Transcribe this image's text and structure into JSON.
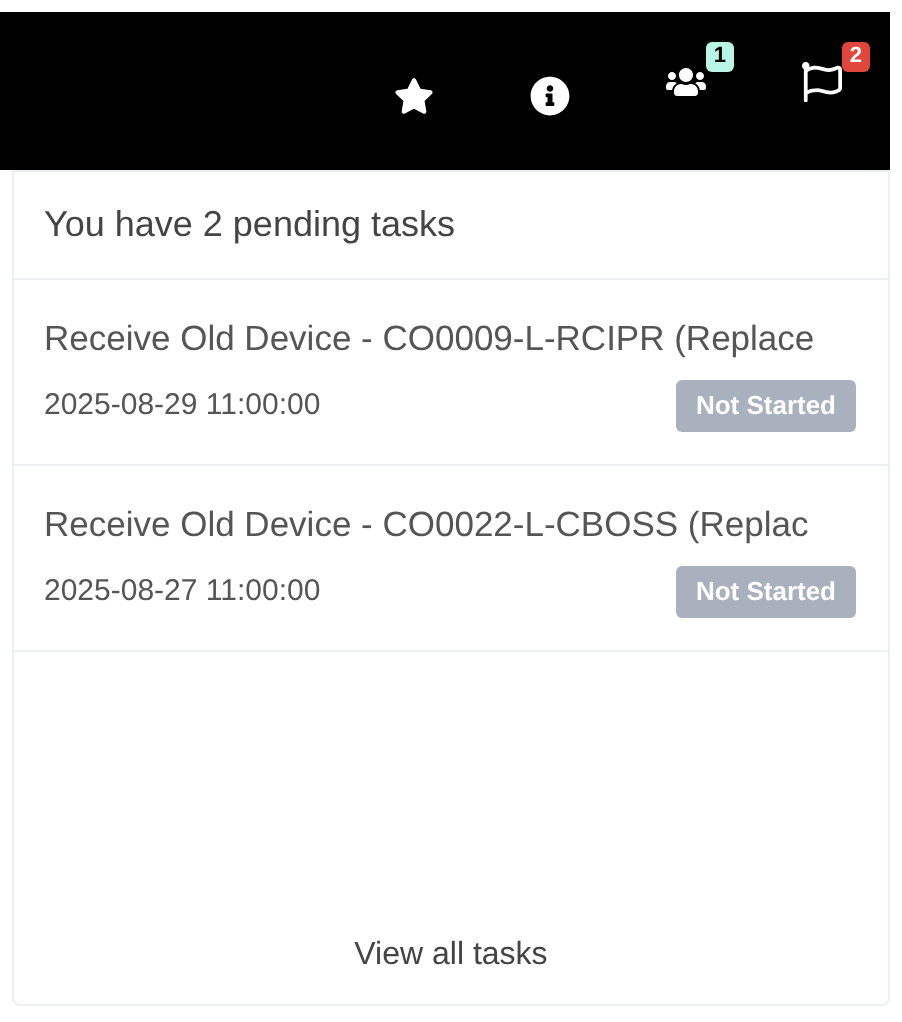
{
  "toolbar": {
    "items": [
      {
        "kind": "star"
      },
      {
        "kind": "info"
      },
      {
        "kind": "users",
        "badge": "1",
        "color": "#b9f5e4"
      },
      {
        "kind": "flag",
        "badge": "2",
        "color": "#e0463c"
      }
    ]
  },
  "tasks_panel": {
    "header": "You have 2 pending tasks",
    "tasks": [
      {
        "title": "Receive Old Device - CO0009-L-RCIPR (Replace",
        "date": "2025-08-29 11:00:00",
        "status": "Not Started"
      },
      {
        "title": "Receive Old Device - CO0022-L-CBOSS (Replac",
        "date": "2025-08-27 11:00:00",
        "status": "Not Started"
      }
    ],
    "footer_link": "View all tasks"
  }
}
